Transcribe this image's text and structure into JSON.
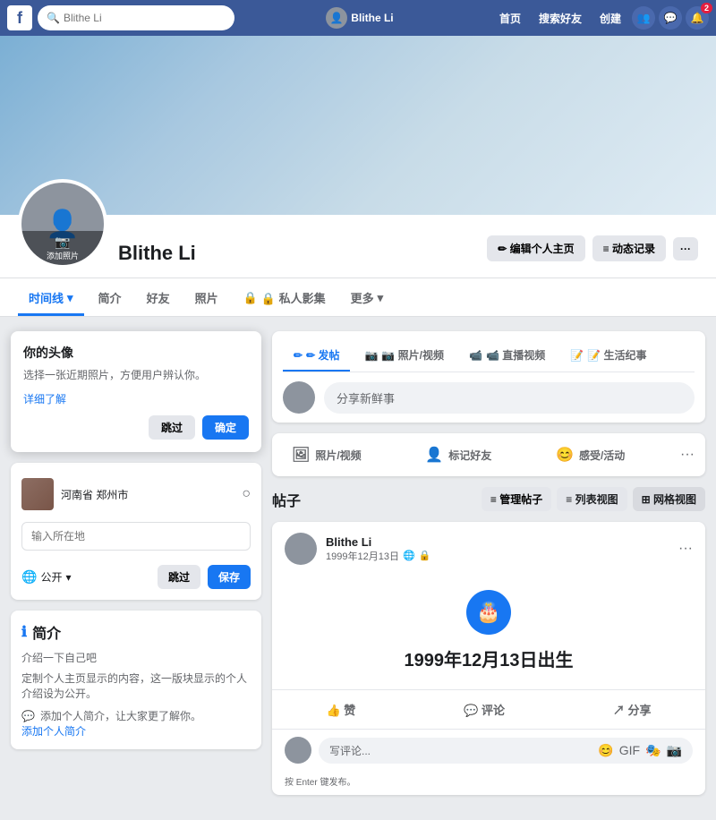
{
  "nav": {
    "logo": "f",
    "search_placeholder": "Blithe Li",
    "user_name": "Blithe Li",
    "links": [
      "首页",
      "搜索好友",
      "创建"
    ],
    "badge_count": "2"
  },
  "profile": {
    "name": "Blithe Li",
    "edit_btn": "✏ 编辑个人主页",
    "activity_btn": "≡ 动态记录",
    "more_btn": "···",
    "avatar_text": "添加照片",
    "tabs": [
      "时间线",
      "简介",
      "好友",
      "照片",
      "🔒 私人影集",
      "更多"
    ]
  },
  "tooltip": {
    "title": "你的头像",
    "description": "选择一张近期照片，方便用户辨认你。",
    "link_text": "详细了解",
    "skip_btn": "跳过",
    "confirm_btn": "确定"
  },
  "left_panel": {
    "location": {
      "city": "河南省 郑州市",
      "checkin_icon": "📍"
    },
    "input_placeholder": "输入所在地",
    "privacy": "公开",
    "skip_btn": "跳过",
    "save_btn": "保存",
    "bio_section_title": "简介",
    "bio_section_icon": "ℹ",
    "bio_prompt": "介绍一下自己吧",
    "bio_desc": "定制个人主页显示的内容，这一版块显示的个人介绍设为公开。",
    "add_bio_text": "添加个人简介，让大家更了解你。",
    "add_bio_link": "添加个人简介"
  },
  "post_composer": {
    "tabs": [
      "✏ 发帖",
      "📷 照片/视频",
      "📹 直播视频",
      "📝 生活纪事"
    ],
    "placeholder": "分享新鲜事"
  },
  "post_actions": {
    "photo_video": "照片/视频",
    "tag_friend": "标记好友",
    "feeling": "感受/活动",
    "more": "···"
  },
  "posts_header": {
    "title": "帖子",
    "manage_btn": "≡ 管理帖子",
    "list_view": "≡ 列表视图",
    "grid_view": "⊞ 网格视图"
  },
  "post": {
    "author": "Blithe Li",
    "date": "1999年12月13日",
    "privacy_icon": "🌐",
    "birth_text": "1999年12月13日出生",
    "birth_icon": "🎂",
    "reactions": {
      "like": "👍 赞",
      "comment": "💬 评论",
      "share": "↗ 分享"
    },
    "comment_placeholder": "写评论...",
    "comment_hint": "按 Enter 键发布。",
    "more_btn": "···"
  }
}
